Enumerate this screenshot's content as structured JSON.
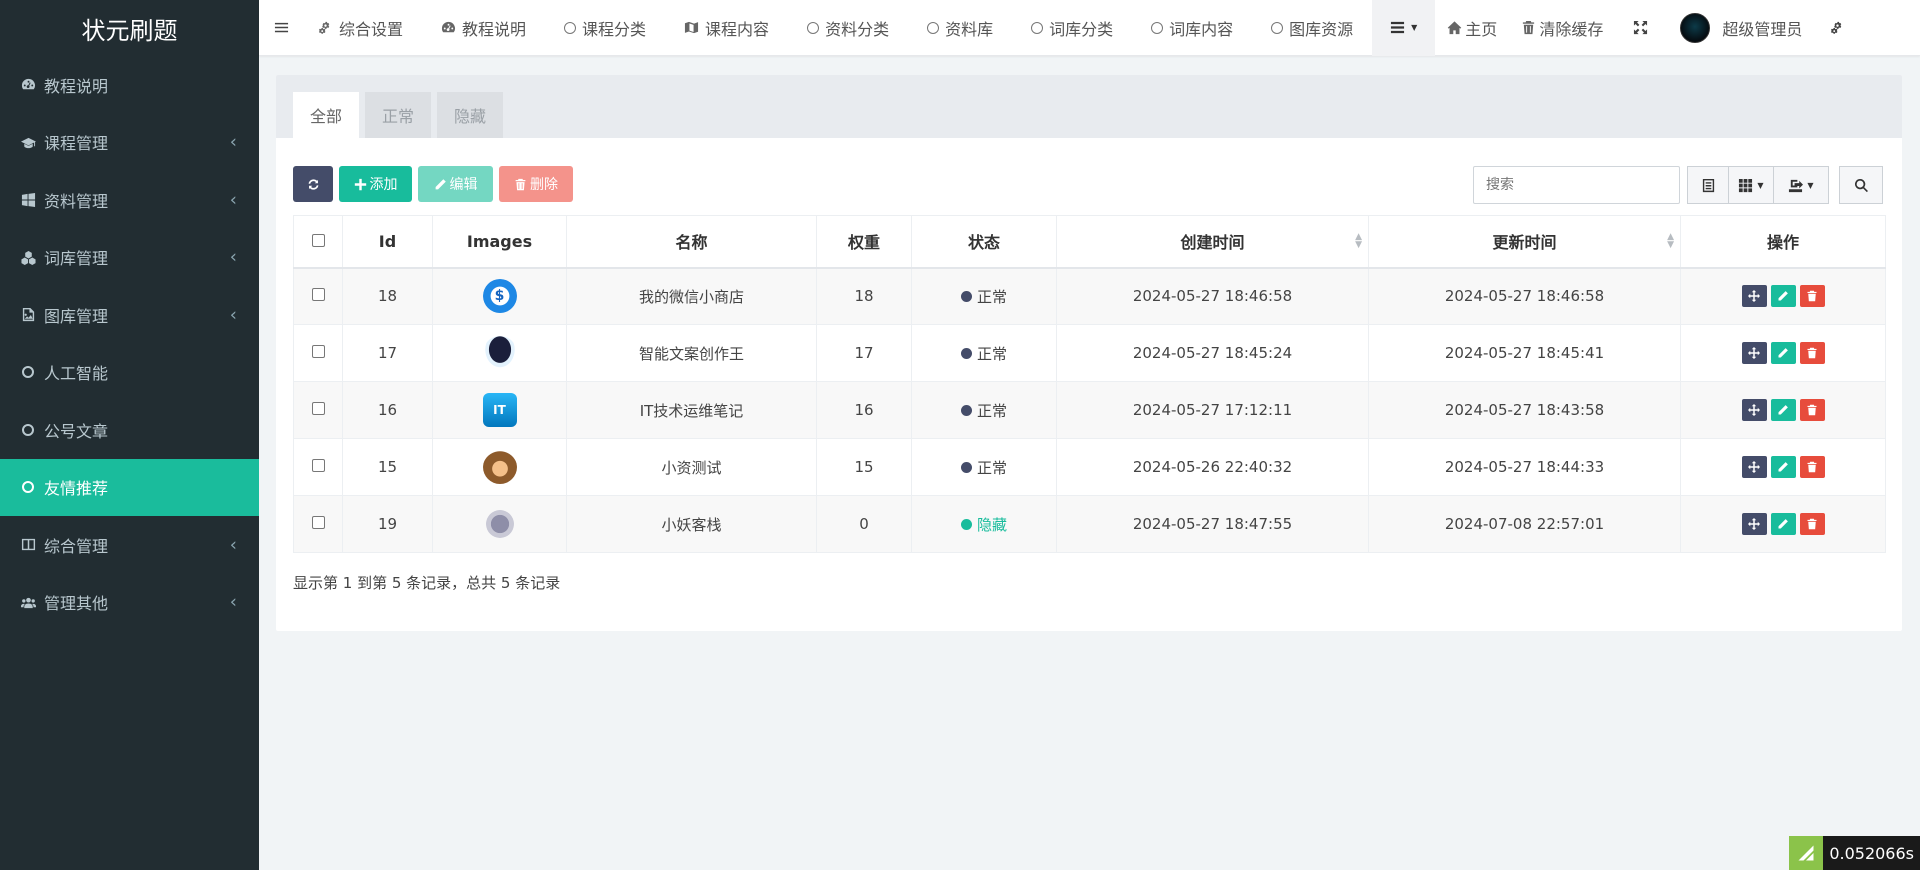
{
  "app": {
    "brand": "状元刷题"
  },
  "sidebar": {
    "items": [
      {
        "label": "教程说明",
        "icon": "dashboard-icon",
        "caret": false,
        "active": false
      },
      {
        "label": "课程管理",
        "icon": "graduation-cap-icon",
        "caret": true,
        "active": false
      },
      {
        "label": "资料管理",
        "icon": "windows-icon",
        "caret": true,
        "active": false
      },
      {
        "label": "词库管理",
        "icon": "cubes-icon",
        "caret": true,
        "active": false
      },
      {
        "label": "图库管理",
        "icon": "image-file-icon",
        "caret": true,
        "active": false
      },
      {
        "label": "人工智能",
        "icon": "circle-icon",
        "caret": false,
        "active": false
      },
      {
        "label": "公号文章",
        "icon": "circle-icon",
        "caret": false,
        "active": false
      },
      {
        "label": "友情推荐",
        "icon": "circle-icon",
        "caret": false,
        "active": true
      },
      {
        "label": "综合管理",
        "icon": "columns-icon",
        "caret": true,
        "active": false
      },
      {
        "label": "管理其他",
        "icon": "users-icon",
        "caret": true,
        "active": false
      }
    ]
  },
  "topnav": {
    "items": [
      {
        "label": "综合设置",
        "icon": "cogs-icon"
      },
      {
        "label": "教程说明",
        "icon": "dashboard-icon"
      },
      {
        "label": "课程分类",
        "icon": "circle-icon"
      },
      {
        "label": "课程内容",
        "icon": "map-icon"
      },
      {
        "label": "资料分类",
        "icon": "circle-icon"
      },
      {
        "label": "资料库",
        "icon": "circle-icon"
      },
      {
        "label": "词库分类",
        "icon": "circle-icon"
      },
      {
        "label": "词库内容",
        "icon": "circle-icon"
      },
      {
        "label": "图库资源",
        "icon": "circle-icon"
      }
    ],
    "home": "主页",
    "clear_cache": "清除缓存",
    "user": "超级管理员"
  },
  "tabs": [
    "全部",
    "正常",
    "隐藏"
  ],
  "toolbar": {
    "add": "添加",
    "edit": "编辑",
    "delete": "删除",
    "search_placeholder": "搜索"
  },
  "table": {
    "columns": [
      "Id",
      "Images",
      "名称",
      "权重",
      "状态",
      "创建时间",
      "更新时间",
      "操作"
    ],
    "rows": [
      {
        "id": "18",
        "image": "dollar-cycle-icon",
        "name": "我的微信小商店",
        "weight": "18",
        "status": "正常",
        "created": "2024-05-27 18:46:58",
        "updated": "2024-05-27 18:46:58"
      },
      {
        "id": "17",
        "image": "robot-icon",
        "name": "智能文案创作王",
        "weight": "17",
        "status": "正常",
        "created": "2024-05-27 18:45:24",
        "updated": "2024-05-27 18:45:41"
      },
      {
        "id": "16",
        "image": "cloud-logo-icon",
        "name": "IT技术运维笔记",
        "weight": "16",
        "status": "正常",
        "created": "2024-05-27 17:12:11",
        "updated": "2024-05-27 18:43:58"
      },
      {
        "id": "15",
        "image": "monkey-icon",
        "name": "小资测试",
        "weight": "15",
        "status": "正常",
        "created": "2024-05-26 22:40:32",
        "updated": "2024-05-27 18:44:33"
      },
      {
        "id": "19",
        "image": "pagoda-icon",
        "name": "小妖客栈",
        "weight": "0",
        "status": "隐藏",
        "created": "2024-05-27 18:47:55",
        "updated": "2024-07-08 22:57:01"
      }
    ]
  },
  "summary": "显示第 1 到第 5 条记录，总共 5 条记录",
  "perf": "0.052066s",
  "colors": {
    "sidebar_bg": "#222d32",
    "accent": "#18bc9c",
    "status_normal": "#444c69",
    "status_hidden": "#18bc9c",
    "delete": "#e74c3c"
  }
}
